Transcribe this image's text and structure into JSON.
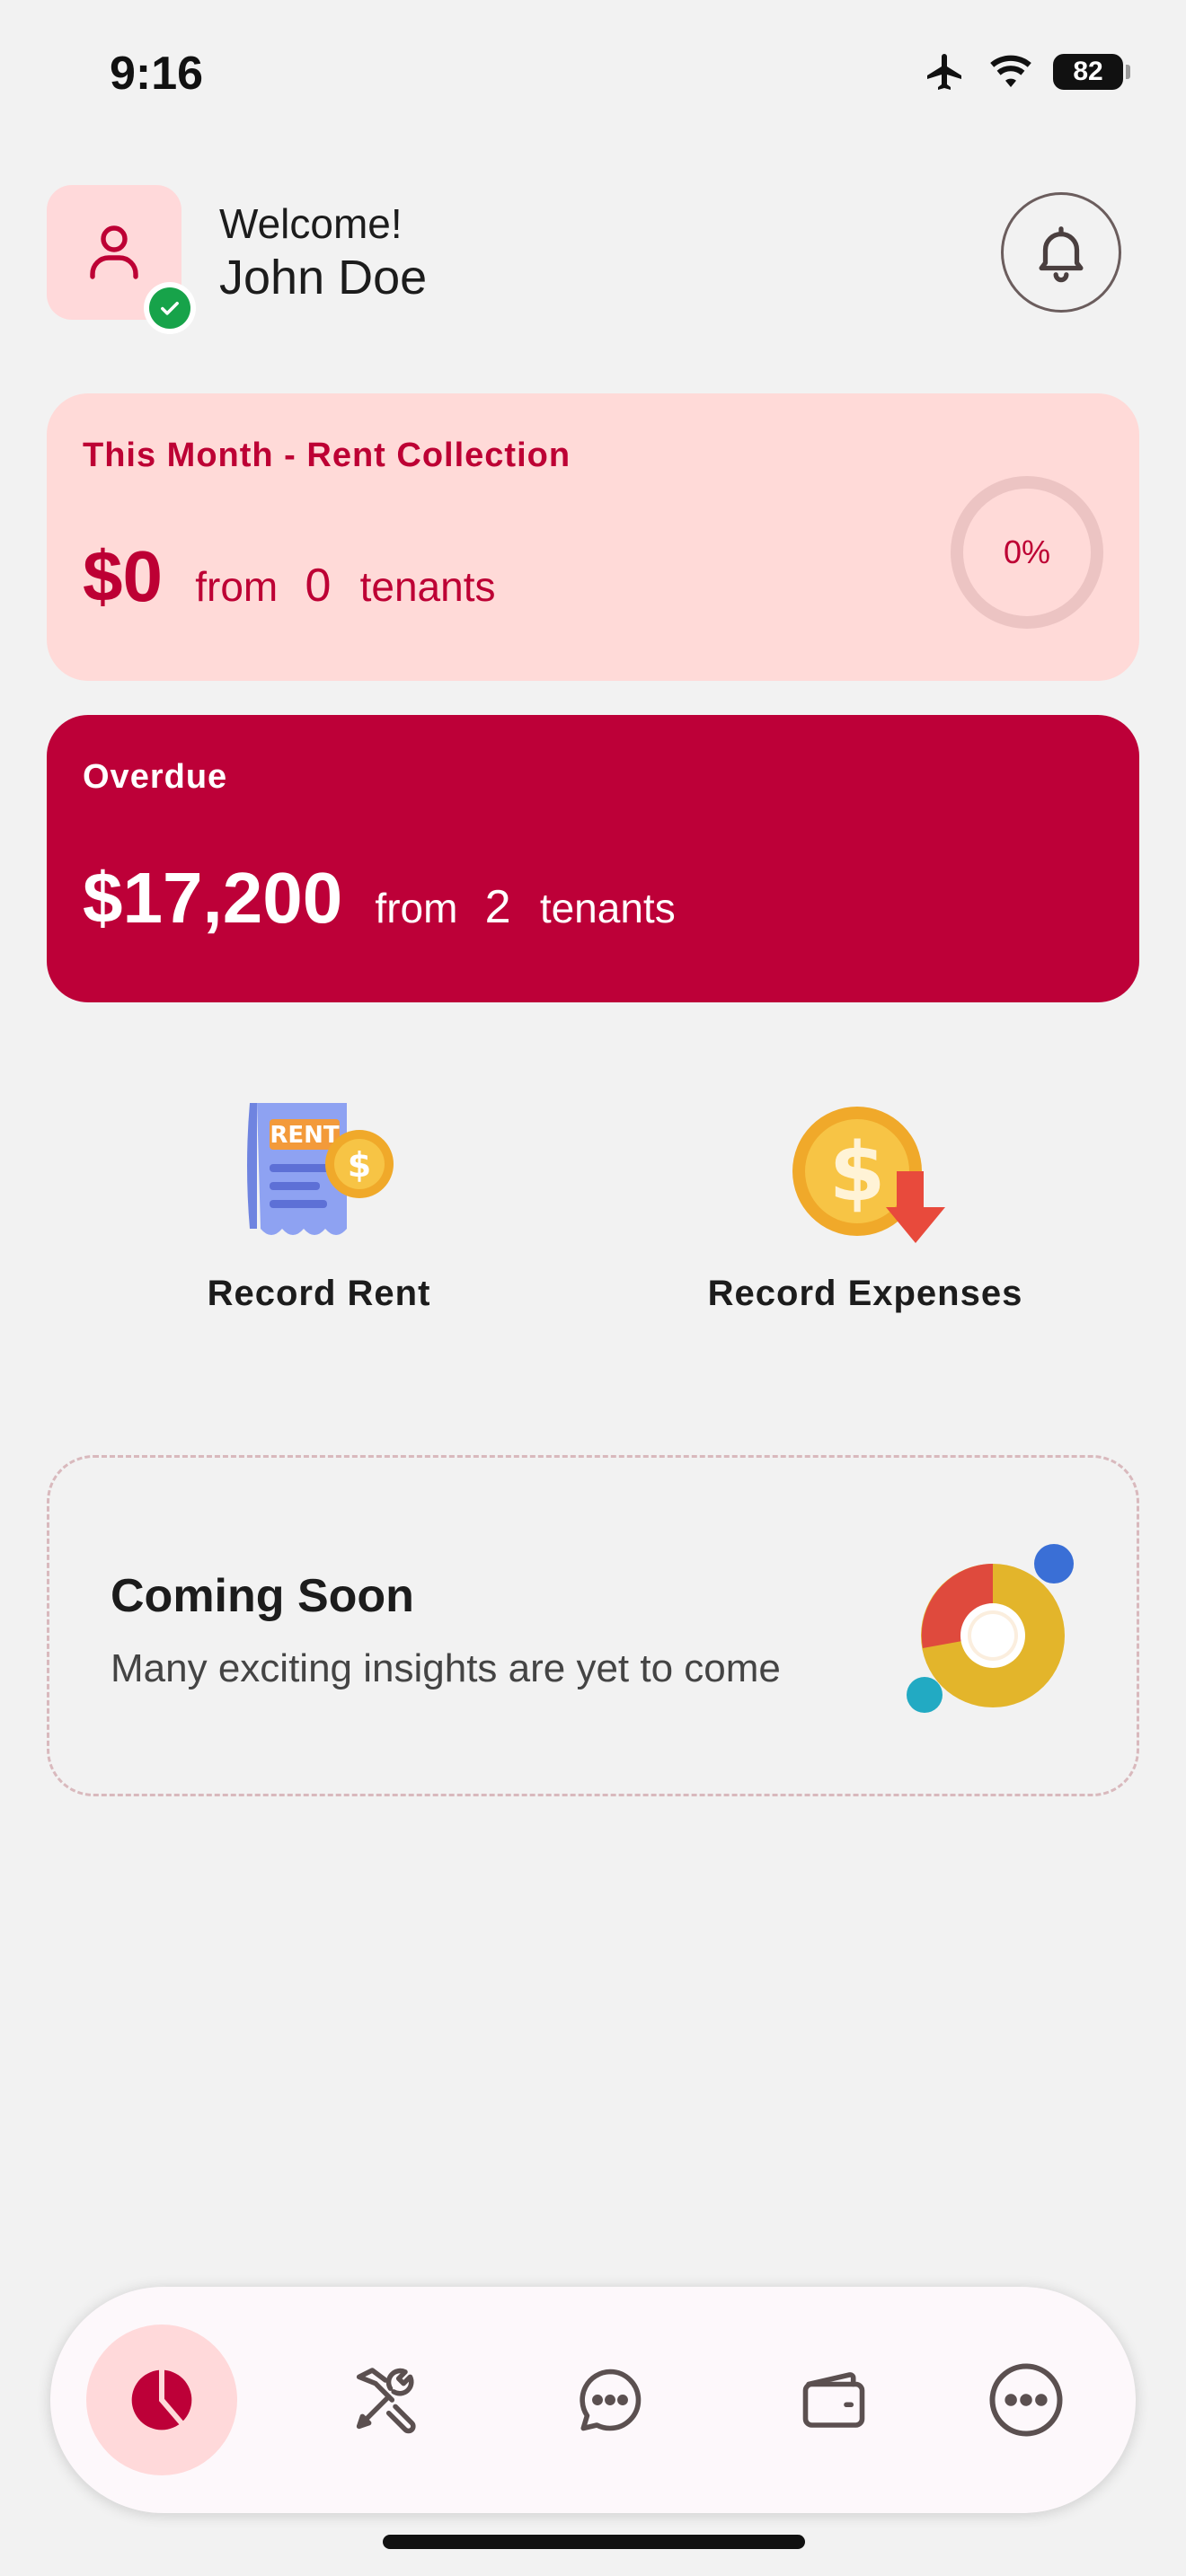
{
  "status_bar": {
    "time": "9:16",
    "battery": "82"
  },
  "header": {
    "welcome": "Welcome!",
    "name": "John Doe"
  },
  "rent_card": {
    "title": "This Month - Rent Collection",
    "amount": "$0",
    "from": "from",
    "count": "0",
    "tenants": "tenants",
    "progress_label": "0%",
    "progress": 0
  },
  "overdue_card": {
    "title": "Overdue",
    "amount": "$17,200",
    "from": "from",
    "count": "2",
    "tenants": "tenants"
  },
  "actions": {
    "record_rent": "Record Rent",
    "rent_badge": "RENT",
    "record_expenses": "Record Expenses"
  },
  "coming_soon": {
    "title": "Coming Soon",
    "subtitle": "Many exciting insights are yet to come"
  },
  "bottom_nav": {
    "items": [
      {
        "icon": "pie-chart-icon",
        "active": true
      },
      {
        "icon": "tools-icon",
        "active": false
      },
      {
        "icon": "chat-icon",
        "active": false
      },
      {
        "icon": "wallet-icon",
        "active": false
      },
      {
        "icon": "more-icon",
        "active": false
      }
    ]
  },
  "colors": {
    "accent": "#bd0038",
    "accent_light": "#ffdad8",
    "success": "#17a34a",
    "background": "#f2f2f2"
  }
}
